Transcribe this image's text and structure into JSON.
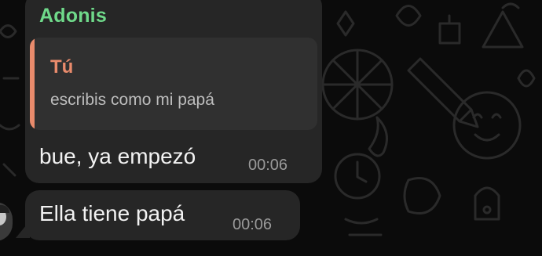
{
  "message_group": {
    "sender": "Adonis",
    "quote": {
      "author": "Tú",
      "text": "escribis como mi papá"
    },
    "messages": [
      {
        "text": "bue, ya empezó",
        "time": "00:06"
      },
      {
        "text": "Ella tiene papá",
        "time": "00:06"
      }
    ]
  },
  "colors": {
    "sender_name": "#6fd98a",
    "quote_accent": "#e98b6c",
    "bubble": "#262626",
    "background": "#0b0b0b"
  },
  "icons": [
    "whatsapp-doodle-wallpaper",
    "avatar"
  ]
}
